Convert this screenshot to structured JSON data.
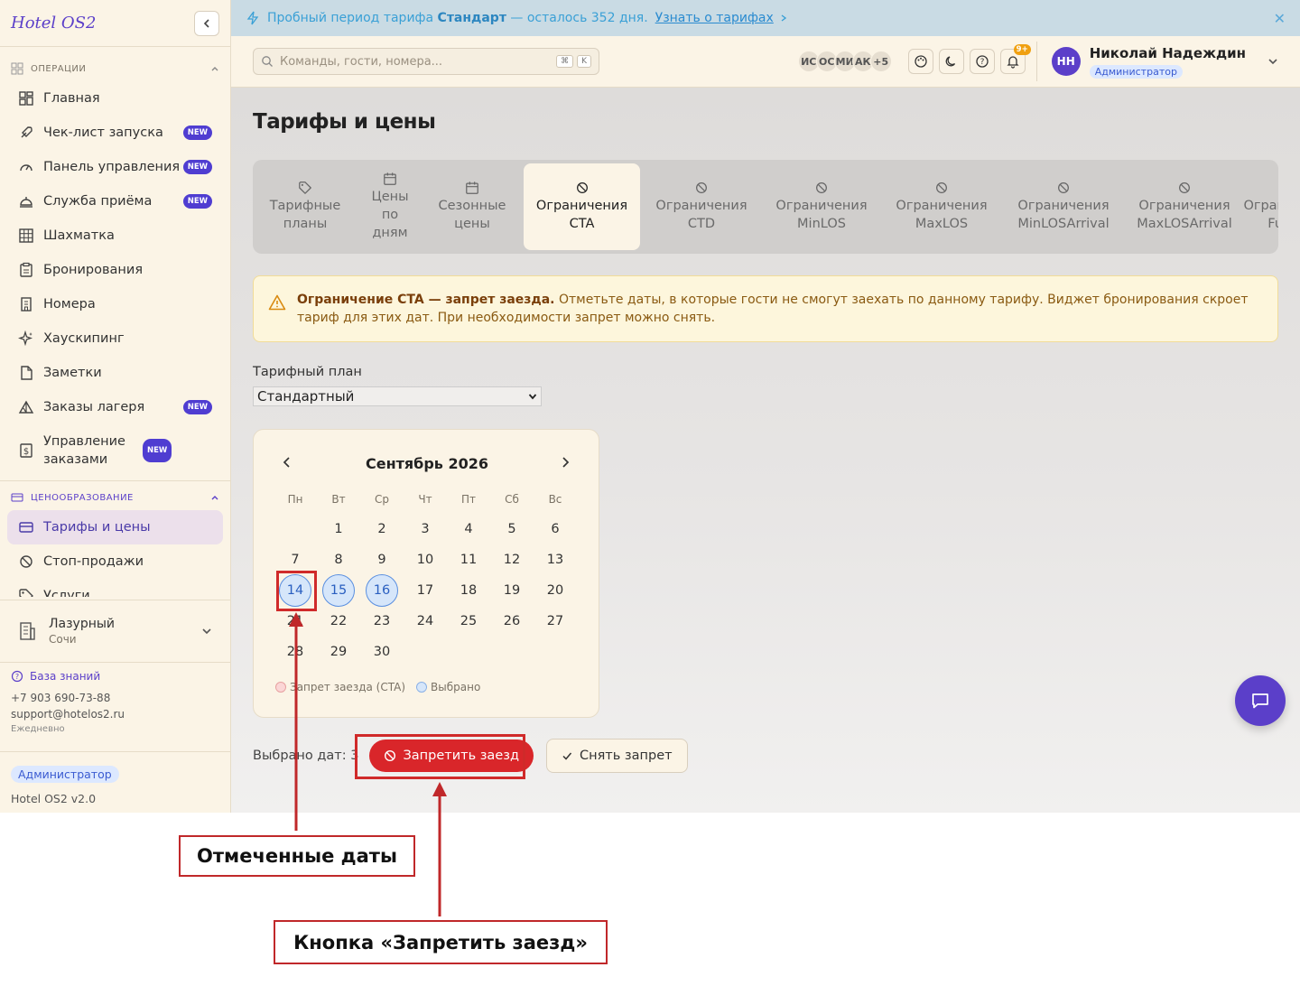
{
  "app": {
    "title": "Hotel OS2"
  },
  "sidebar": {
    "operations_heading": "ОПЕРАЦИИ",
    "pricing_heading": "ЦЕНООБРАЗОВАНИЕ",
    "new_badge": "NEW",
    "items": [
      {
        "label": "Главная",
        "icon": "dashboard-icon"
      },
      {
        "label": "Чек-лист запуска",
        "icon": "rocket-icon",
        "new": true
      },
      {
        "label": "Панель управления",
        "icon": "gauge-icon",
        "new": true
      },
      {
        "label": "Служба приёма",
        "icon": "bell-desk-icon",
        "new": true
      },
      {
        "label": "Шахматка",
        "icon": "grid-icon"
      },
      {
        "label": "Бронирования",
        "icon": "clipboard-icon"
      },
      {
        "label": "Номера",
        "icon": "building-icon"
      },
      {
        "label": "Хаускипинг",
        "icon": "sparkle-icon"
      },
      {
        "label": "Заметки",
        "icon": "note-icon"
      },
      {
        "label": "Заказы лагеря",
        "icon": "tent-icon",
        "new": true
      },
      {
        "label": "Управление заказами",
        "icon": "dollar-icon",
        "new": true
      }
    ],
    "pricing_items": [
      {
        "label": "Тарифы и цены",
        "icon": "card-icon",
        "active": true
      },
      {
        "label": "Стоп-продажи",
        "icon": "ban-icon"
      },
      {
        "label": "Услуги",
        "icon": "tag-icon"
      }
    ],
    "hotel": {
      "name": "Лазурный",
      "city": "Сочи"
    },
    "support": {
      "kb": "База знаний",
      "phone": "+7 903 690-73-88",
      "email": "support@hotelos2.ru",
      "hours": "Ежедневно"
    },
    "role": "Администратор",
    "version": "Hotel OS2 v2.0"
  },
  "trial": {
    "prefix": "Пробный период тарифа",
    "plan": "Стандарт",
    "suffix": "— осталось 352 дня.",
    "link": "Узнать о тарифах"
  },
  "topbar": {
    "search_placeholder": "Команды, гости, номера...",
    "kbd1": "⌘",
    "kbd2": "K",
    "avatars": [
      "ИС",
      "ОС",
      "МИ",
      "АК",
      "+5"
    ],
    "notif_count": "9+",
    "user_initials": "НН",
    "user_name": "Николай Надеждин",
    "user_role": "Администратор"
  },
  "page": {
    "title": "Тарифы и цены",
    "tabs": [
      {
        "label": "Тарифные планы",
        "icon": "tag-icon"
      },
      {
        "label": "Цены по дням",
        "icon": "calendar-icon"
      },
      {
        "label": "Сезонные цены",
        "icon": "calendar-icon"
      },
      {
        "label": "Ограничения CTA",
        "icon": "ban-icon",
        "active": true
      },
      {
        "label": "Ограничения CTD",
        "icon": "ban-icon"
      },
      {
        "label": "Ограничения MinLOS",
        "icon": "ban-icon"
      },
      {
        "label": "Ограничения MaxLOS",
        "icon": "ban-icon"
      },
      {
        "label": "Ограничения MinLOSArrival",
        "icon": "ban-icon"
      },
      {
        "label": "Ограничения MaxLOSArrival",
        "icon": "ban-icon"
      },
      {
        "label": "Ограничения FullPat",
        "icon": "ban-icon"
      }
    ],
    "alert_bold": "Ограничение CTA — запрет заезда.",
    "alert_text": "Отметьте даты, в которые гости не смогут заехать по данному тарифу. Виджет бронирования скроет тариф для этих дат. При необходимости запрет можно снять.",
    "plan_label": "Тарифный план",
    "plan_value": "Стандартный",
    "calendar": {
      "month": "Сентябрь 2026",
      "weekdays": [
        "Пн",
        "Вт",
        "Ср",
        "Чт",
        "Пт",
        "Сб",
        "Вс"
      ],
      "first_weekday_offset": 1,
      "days_in_month": 30,
      "selected": [
        14,
        15,
        16
      ],
      "legend_cta": "Запрет заезда (CTA)",
      "legend_selected": "Выбрано"
    },
    "selected_count": "Выбрано дат: 3",
    "ban_button": "Запретить заезд",
    "lift_button": "Снять запрет"
  },
  "annotations": {
    "dates_callout": "Отмеченные даты",
    "button_callout": "Кнопка «Запретить заезд»"
  },
  "colors": {
    "accent": "#5b3fc9",
    "danger": "#d9262a",
    "selected": "#d6e6fa"
  }
}
